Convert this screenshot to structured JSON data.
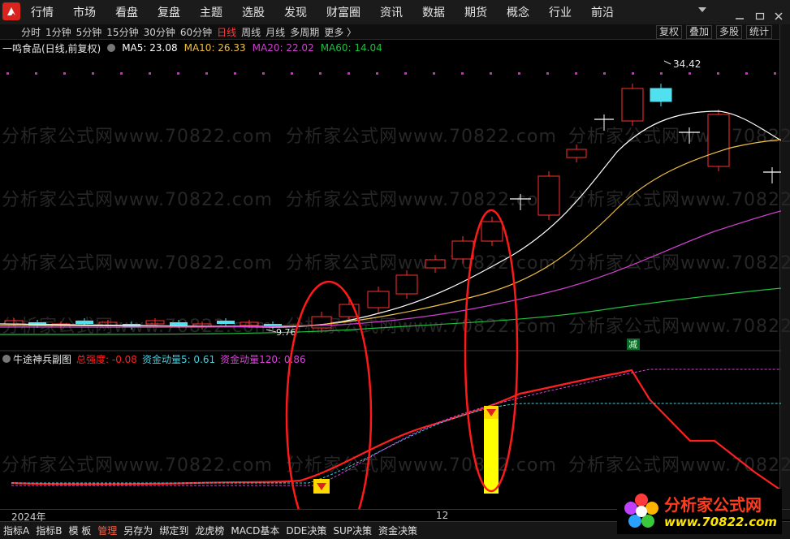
{
  "menu": [
    "行情",
    "市场",
    "看盘",
    "复盘",
    "主题",
    "选股",
    "发现",
    "财富圈",
    "资讯",
    "数据",
    "期货",
    "概念",
    "行业",
    "前沿"
  ],
  "periods": [
    "分时",
    "1分钟",
    "5分钟",
    "15分钟",
    "30分钟",
    "60分钟",
    "日线",
    "周线",
    "月线",
    "多周期",
    "更多 〉"
  ],
  "active_period": "日线",
  "right_buttons": [
    "复权",
    "叠加",
    "多股",
    "统计"
  ],
  "stock": {
    "name": "一鸣食品(日线,前复权)"
  },
  "ma": {
    "ma5": {
      "label": "MA5: 23.08",
      "color": "#ffffff"
    },
    "ma10": {
      "label": "MA10: 26.33",
      "color": "#f0c040"
    },
    "ma20": {
      "label": "MA20: 22.02",
      "color": "#d040d0"
    },
    "ma60": {
      "label": "MA60: 14.04",
      "color": "#20c040"
    }
  },
  "chart_labels": {
    "high": "34.42",
    "low": "9.76",
    "signal": "减"
  },
  "indicator": {
    "name": "牛途神兵副图",
    "total": {
      "label": "总强度: -0.08",
      "color": "#ff2020"
    },
    "f5": {
      "label": "资金动量5: 0.61",
      "color": "#40d0e0"
    },
    "f120": {
      "label": "资金动量120: 0.86",
      "color": "#e040e0"
    }
  },
  "axis": {
    "year": "2024年",
    "month": "12"
  },
  "bottom_tabs": [
    "指标A",
    "指标B",
    "模 板",
    "管理",
    "另存为",
    "绑定到",
    "龙虎榜",
    "MACD基本",
    "DDE决策",
    "SUP决策",
    "资金决策"
  ],
  "active_bottom": "管理",
  "watermark": "分析家公式网www.70822.com",
  "badge": {
    "title": "分析家公式网",
    "url": "www.70822.com"
  },
  "colors": {
    "up": "#ff3030",
    "down": "#50e0f0",
    "brand_red": "#d8241f",
    "highlight_oval": "#ff1a1a",
    "bar_yellow": "#ffff00"
  }
}
